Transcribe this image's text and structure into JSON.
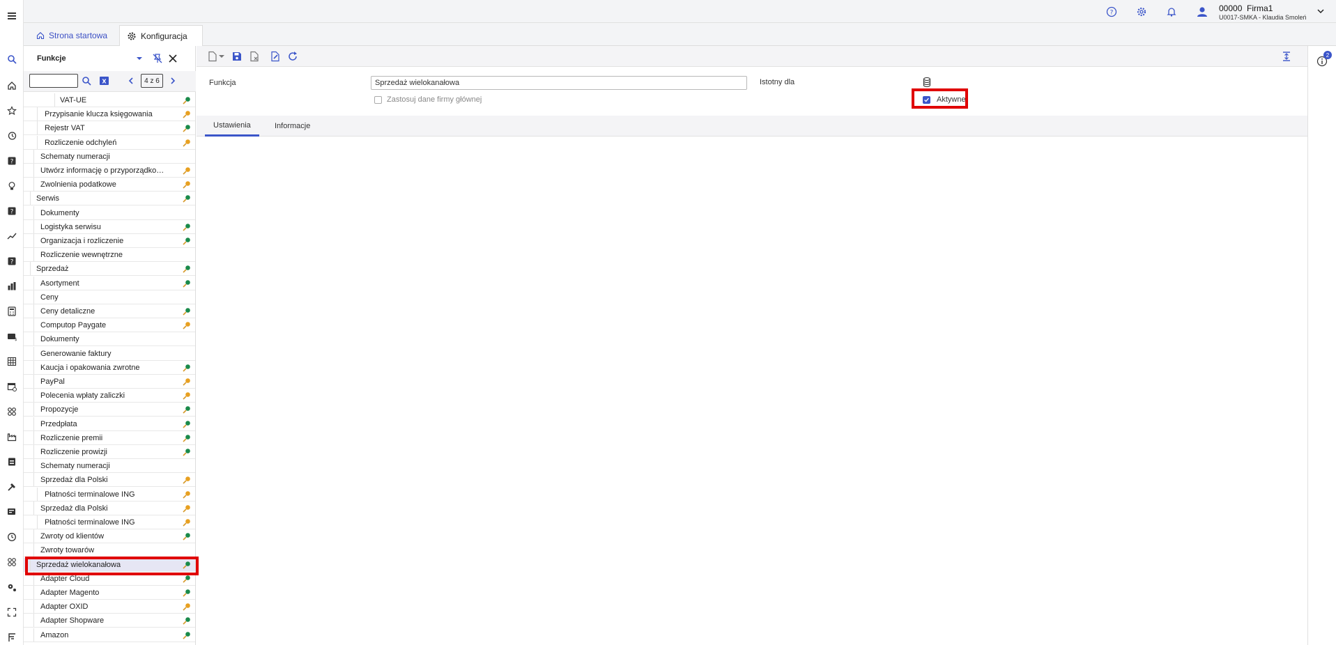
{
  "header": {
    "company_code": "00000",
    "company_name": "Firma1",
    "user": "U0017-SMKA - Klaudia Smoleń"
  },
  "tabs": [
    {
      "label": "Strona startowa"
    },
    {
      "label": "Konfiguracja"
    }
  ],
  "panel": {
    "title": "Funkcje",
    "search_value": "",
    "pager": "4 z 6"
  },
  "tree": [
    {
      "label": "VAT-UE",
      "status": "green"
    },
    {
      "label": "Przypisanie klucza księgowania",
      "status": "orange"
    },
    {
      "label": "Rejestr VAT",
      "status": "green"
    },
    {
      "label": "Rozliczenie odchyleń",
      "status": "orange"
    },
    {
      "label": "Schematy numeracji",
      "status": ""
    },
    {
      "label": "Utwórz informację o przyporządkowa...",
      "status": "orange"
    },
    {
      "label": "Zwolnienia podatkowe",
      "status": "orange"
    },
    {
      "label": "Serwis",
      "status": "green"
    },
    {
      "label": "Dokumenty",
      "status": ""
    },
    {
      "label": "Logistyka serwisu",
      "status": "green"
    },
    {
      "label": "Organizacja i rozliczenie",
      "status": "green"
    },
    {
      "label": "Rozliczenie wewnętrzne",
      "status": ""
    },
    {
      "label": "Sprzedaż",
      "status": "green"
    },
    {
      "label": "Asortyment",
      "status": "green"
    },
    {
      "label": "Ceny",
      "status": ""
    },
    {
      "label": "Ceny detaliczne",
      "status": "green"
    },
    {
      "label": "Computop Paygate",
      "status": "orange"
    },
    {
      "label": "Dokumenty",
      "status": ""
    },
    {
      "label": "Generowanie faktury",
      "status": ""
    },
    {
      "label": "Kaucja i opakowania zwrotne",
      "status": "green"
    },
    {
      "label": "PayPal",
      "status": "orange"
    },
    {
      "label": "Polecenia wpłaty zaliczki",
      "status": "orange"
    },
    {
      "label": "Propozycje",
      "status": "green"
    },
    {
      "label": "Przedpłata",
      "status": "green"
    },
    {
      "label": "Rozliczenie premii",
      "status": "green"
    },
    {
      "label": "Rozliczenie prowizji",
      "status": "green"
    },
    {
      "label": "Schematy numeracji",
      "status": ""
    },
    {
      "label": "Sprzedaż dla Polski",
      "status": "orange"
    },
    {
      "label": "Płatności terminalowe ING",
      "status": "orange"
    },
    {
      "label": "Sprzedaż dla Polski",
      "status": "orange"
    },
    {
      "label": "Płatności terminalowe ING",
      "status": "orange"
    },
    {
      "label": "Zwroty od klientów",
      "status": "green"
    },
    {
      "label": "Zwroty towarów",
      "status": ""
    },
    {
      "label": "Sprzedaż wielokanałowa",
      "status": "green",
      "selected": true
    },
    {
      "label": "Adapter Cloud",
      "status": "green"
    },
    {
      "label": "Adapter Magento",
      "status": "green"
    },
    {
      "label": "Adapter OXID",
      "status": "orange"
    },
    {
      "label": "Adapter Shopware",
      "status": "green"
    },
    {
      "label": "Amazon",
      "status": "green"
    }
  ],
  "form": {
    "function_label": "Funkcja",
    "function_value": "Sprzedaż wielokanałowa",
    "apply_label": "Zastosuj dane firmy głównej",
    "relevant_label": "Istotny dla",
    "active_label": "Aktywne"
  },
  "subtabs": [
    {
      "label": "Ustawienia"
    },
    {
      "label": "Informacje"
    }
  ],
  "info_badge": "2",
  "colors": {
    "accent": "#3b55c9",
    "highlight": "#e00000",
    "status_green": "#1a8a4a",
    "status_orange": "#e8a020"
  }
}
